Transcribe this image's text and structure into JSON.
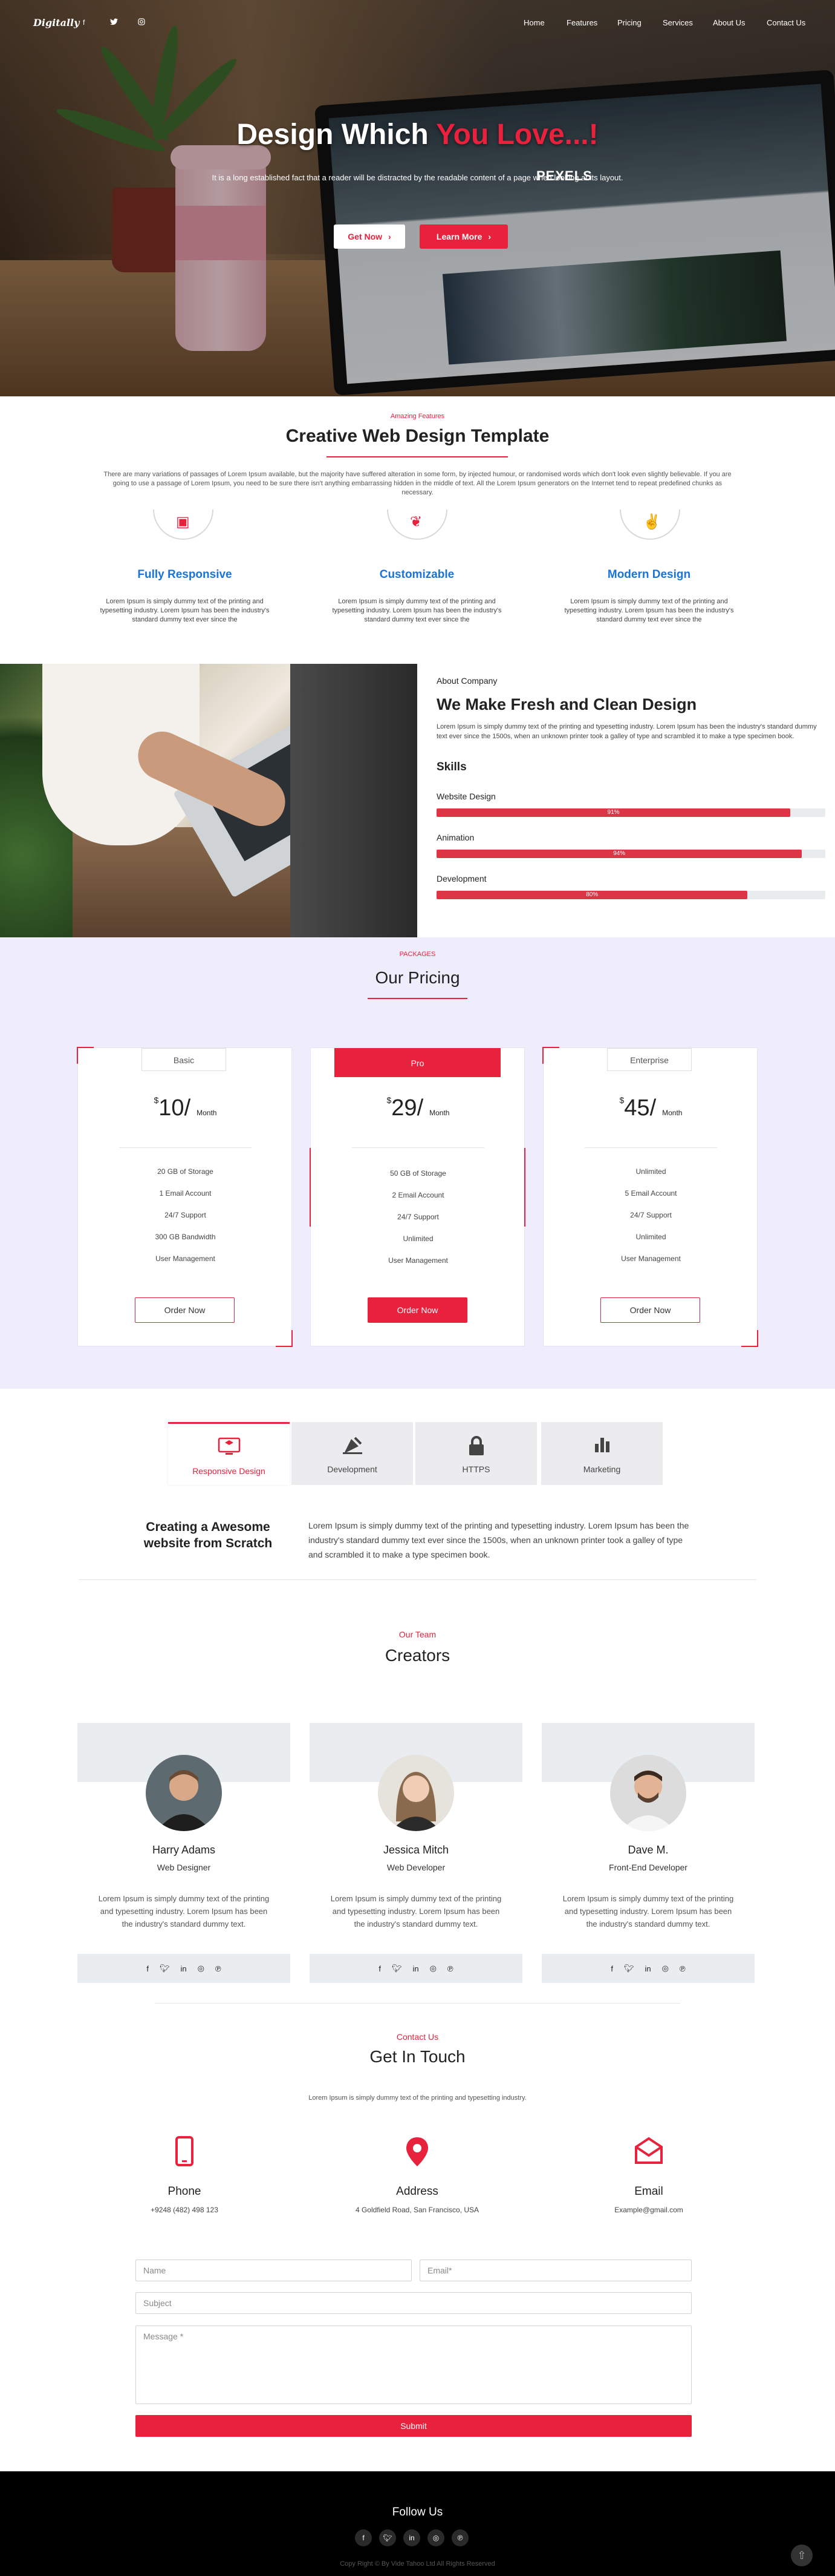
{
  "nav": {
    "logo": "Digitally",
    "social": [
      "f",
      "t",
      "ig"
    ],
    "links": [
      "Home",
      "Features",
      "Pricing",
      "Services",
      "About Us",
      "Contact Us"
    ]
  },
  "hero": {
    "title_white": "Design Which",
    "title_red": "You Love...!",
    "subtitle": "It is a long established fact that a reader will be distracted by the readable content of a page when looking at its layout.",
    "btn_get_now": "Get Now",
    "btn_learn_more": "Learn More",
    "laptop_brand": "PEXELS"
  },
  "features": {
    "eyebrow": "Amazing Features",
    "title": "Creative Web Design Template",
    "intro": "There are many variations of passages of Lorem Ipsum available, but the majority have suffered alteration in some form, by injected humour, or randomised words which don't look even slightly believable. If you are going to use a passage of Lorem Ipsum, you need to be sure there isn't anything embarrassing hidden in the middle of text. All the Lorem Ipsum generators on the Internet tend to repeat predefined chunks as necessary.",
    "items": [
      {
        "title": "Fully Responsive",
        "desc": "Lorem Ipsum is simply dummy text of the printing and typesetting industry. Lorem Ipsum has been the industry's standard dummy text ever since the",
        "icon": "mobile-icon"
      },
      {
        "title": "Customizable",
        "desc": "Lorem Ipsum is simply dummy text of the printing and typesetting industry. Lorem Ipsum has been the industry's standard dummy text ever since the",
        "icon": "handshake-icon"
      },
      {
        "title": "Modern Design",
        "desc": "Lorem Ipsum is simply dummy text of the printing and typesetting industry. Lorem Ipsum has been the industry's standard dummy text ever since the",
        "icon": "hand-pointer-icon"
      }
    ]
  },
  "about": {
    "eyebrow": "About Company",
    "title": "We Make Fresh and Clean Design",
    "para": "Lorem Ipsum is simply dummy text of the printing and typesetting industry. Lorem Ipsum has been the industry's standard dummy text ever since the 1500s, when an unknown printer took a galley of type and scrambled it to make a type specimen book.",
    "skills_title": "Skills",
    "skills": [
      {
        "name": "Website Design",
        "label": "91%",
        "value": 91
      },
      {
        "name": "Animation",
        "label": "94%",
        "value": 94
      },
      {
        "name": "Development",
        "label": "80%",
        "value": 80
      }
    ]
  },
  "pricing": {
    "eyebrow": "PACKAGES",
    "title": "Our Pricing",
    "plans": [
      {
        "name": "Basic",
        "currency": "$",
        "price": "10/",
        "period": "Month",
        "features": [
          "20 GB of Storage",
          "1 Email Account",
          "24/7 Support",
          "300 GB Bandwidth",
          "User Management"
        ],
        "button": "Order Now"
      },
      {
        "name": "Pro",
        "currency": "$",
        "price": "29/",
        "period": "Month",
        "features": [
          "50 GB of Storage",
          "2 Email Account",
          "24/7 Support",
          "Unlimited",
          "User Management"
        ],
        "button": "Order Now"
      },
      {
        "name": "Enterprise",
        "currency": "$",
        "price": "45/",
        "period": "Month",
        "features": [
          "Unlimited",
          "5 Email Account",
          "24/7 Support",
          "Unlimited",
          "User Management"
        ],
        "button": "Order Now"
      }
    ]
  },
  "services": {
    "tabs": [
      "Responsive Design",
      "Development",
      "HTTPS",
      "Marketing"
    ],
    "active_title": "Creating a Awesome website from Scratch",
    "active_text": "Lorem Ipsum is simply dummy text of the printing and typesetting industry. Lorem Ipsum has been the industry's standard dummy text ever since the 1500s, when an unknown printer took a galley of type and scrambled it to make a type specimen book."
  },
  "team": {
    "eyebrow": "Our Team",
    "title": "Creators",
    "members": [
      {
        "name": "Harry Adams",
        "role": "Web Designer",
        "desc": "Lorem Ipsum is simply dummy text of the printing and typesetting industry. Lorem Ipsum has been the industry's standard dummy text."
      },
      {
        "name": "Jessica Mitch",
        "role": "Web Developer",
        "desc": "Lorem Ipsum is simply dummy text of the printing and typesetting industry. Lorem Ipsum has been the industry's standard dummy text."
      },
      {
        "name": "Dave M.",
        "role": "Front-End Developer",
        "desc": "Lorem Ipsum is simply dummy text of the printing and typesetting industry. Lorem Ipsum has been the industry's standard dummy text."
      }
    ]
  },
  "contact": {
    "eyebrow": "Contact Us",
    "title": "Get In Touch",
    "intro": "Lorem Ipsum is simply dummy text of the printing and typesetting industry.",
    "phone_label": "Phone",
    "phone_value": "+9248 (482) 498 123",
    "address_label": "Address",
    "address_value": "4 Goldfield Road, San Francisco, USA",
    "email_label": "Email",
    "email_value": "Example@gmail.com",
    "name_placeholder": "Name",
    "email_placeholder": "Email*",
    "subject_placeholder": "Subject",
    "message_placeholder": "Message *",
    "submit": "Submit"
  },
  "footer": {
    "follow": "Follow Us",
    "copyright": "Copy Right © By Vide Tahoo Ltd All Rights Reserved"
  },
  "colors": {
    "accent": "#e8213d",
    "link_blue": "#1a73d9",
    "pricing_bg": "#efedfc",
    "footer_bg": "#000000"
  }
}
